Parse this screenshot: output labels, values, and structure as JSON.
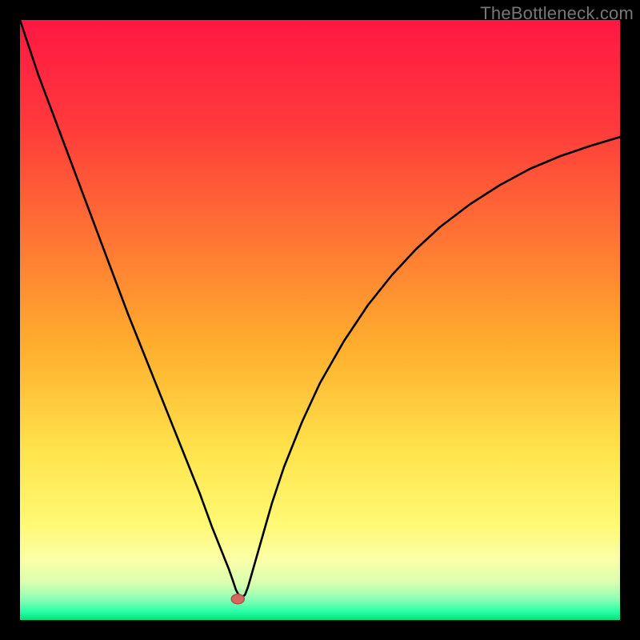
{
  "watermark": "TheBottleneck.com",
  "colors": {
    "frame": "#000000",
    "curve": "#000000",
    "marker_fill": "#d46a5f",
    "marker_stroke": "#b44f45",
    "gradient_stops": [
      {
        "offset": 0.0,
        "color": "#ff1744"
      },
      {
        "offset": 0.18,
        "color": "#ff3b3b"
      },
      {
        "offset": 0.38,
        "color": "#ff7a33"
      },
      {
        "offset": 0.55,
        "color": "#ffb02e"
      },
      {
        "offset": 0.72,
        "color": "#ffe44d"
      },
      {
        "offset": 0.84,
        "color": "#fff973"
      },
      {
        "offset": 0.9,
        "color": "#fbffa8"
      },
      {
        "offset": 0.94,
        "color": "#d7ffb0"
      },
      {
        "offset": 0.965,
        "color": "#8cffb5"
      },
      {
        "offset": 0.985,
        "color": "#2effa8"
      },
      {
        "offset": 1.0,
        "color": "#00e27c"
      }
    ]
  },
  "chart_data": {
    "type": "line",
    "title": "",
    "xlabel": "",
    "ylabel": "",
    "xlim": [
      0,
      100
    ],
    "ylim": [
      0,
      100
    ],
    "x": [
      0,
      3,
      6,
      9,
      12,
      15,
      18,
      21,
      24,
      27,
      30,
      32,
      34,
      34.8,
      35.5,
      36,
      36.5,
      37,
      37.5,
      38,
      39,
      40,
      41,
      42,
      44,
      47,
      50,
      54,
      58,
      62,
      66,
      70,
      75,
      80,
      85,
      90,
      95,
      100
    ],
    "values": [
      100,
      91,
      83,
      75,
      67,
      59,
      51,
      43.5,
      36,
      28.5,
      21,
      15.5,
      10.5,
      8.5,
      6.5,
      5,
      4.1,
      3.8,
      4.2,
      5.5,
      9,
      12.5,
      16,
      19.5,
      25.5,
      33,
      39.5,
      46.5,
      52.5,
      57.5,
      61.8,
      65.5,
      69.3,
      72.5,
      75.2,
      77.3,
      79,
      80.5
    ],
    "marker": {
      "x": 36.3,
      "y": 3.5
    }
  }
}
